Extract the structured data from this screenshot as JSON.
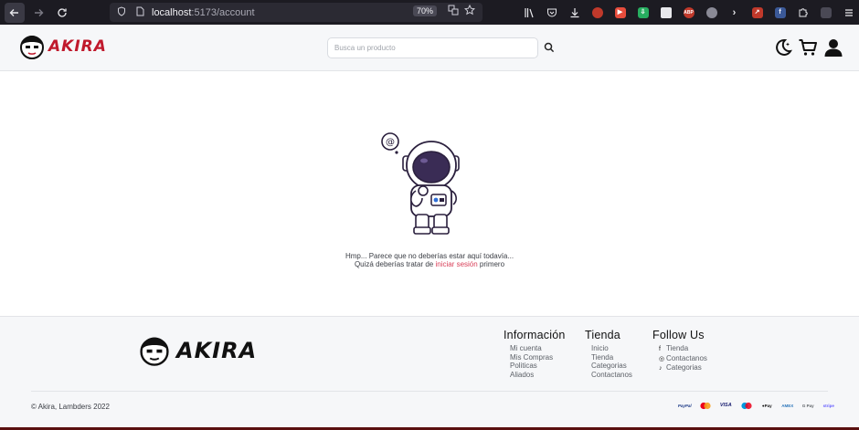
{
  "browser": {
    "url_host": "localhost",
    "url_path": ":5173/account",
    "zoom": "70%",
    "extensions": [
      {
        "name": "extension-1",
        "color": "#c0392b",
        "label": ""
      },
      {
        "name": "extension-2",
        "color": "#e74c3c",
        "label": "▶"
      },
      {
        "name": "extension-3",
        "color": "#27ae60",
        "label": "⇩"
      },
      {
        "name": "extension-4",
        "color": "#e8e8ec",
        "label": ""
      },
      {
        "name": "extension-adblock",
        "color": "#c0392b",
        "label": "ABP"
      },
      {
        "name": "extension-5",
        "color": "#8a8a96",
        "label": ""
      },
      {
        "name": "extension-6",
        "color": "#e8e8ec",
        "label": "›"
      },
      {
        "name": "extension-7",
        "color": "#c0392b",
        "label": "↗"
      },
      {
        "name": "extension-facebook",
        "color": "#3b5998",
        "label": "f"
      },
      {
        "name": "extension-8",
        "color": "#e8e8ec",
        "label": ""
      },
      {
        "name": "extension-9",
        "color": "#4a4955",
        "label": ""
      }
    ]
  },
  "header": {
    "logo_text": "AKIRA",
    "search_placeholder": "Busca un producto"
  },
  "main": {
    "message_line1": "Hmp... Parece que no deberías estar aquí todavía...",
    "message_line2_prefix": "Quizá deberías tratar de ",
    "message_link": "iniciar sesión",
    "message_line2_suffix": " primero"
  },
  "footer": {
    "logo_text": "AKIRA",
    "columns": [
      {
        "title": "Información",
        "items": [
          "Mi cuenta",
          "Mis Compras",
          "Politicas",
          "Aliados"
        ]
      },
      {
        "title": "Tienda",
        "items": [
          "Inicio",
          "Tienda",
          "Categorias",
          "Contactanos"
        ]
      },
      {
        "title": "Follow Us",
        "items": [
          "Tienda",
          "Contactanos",
          "Categorias"
        ]
      }
    ],
    "copyright": "© Akira, Lambders 2022",
    "payments": [
      "PayPal",
      "Mastercard",
      "VISA",
      "Maestro",
      "Apple Pay",
      "Amex",
      "Google Pay",
      "stripe"
    ]
  },
  "colors": {
    "brand_red": "#c0192c",
    "link_pink": "#d9415a",
    "browser_dark": "#1c1b22"
  }
}
